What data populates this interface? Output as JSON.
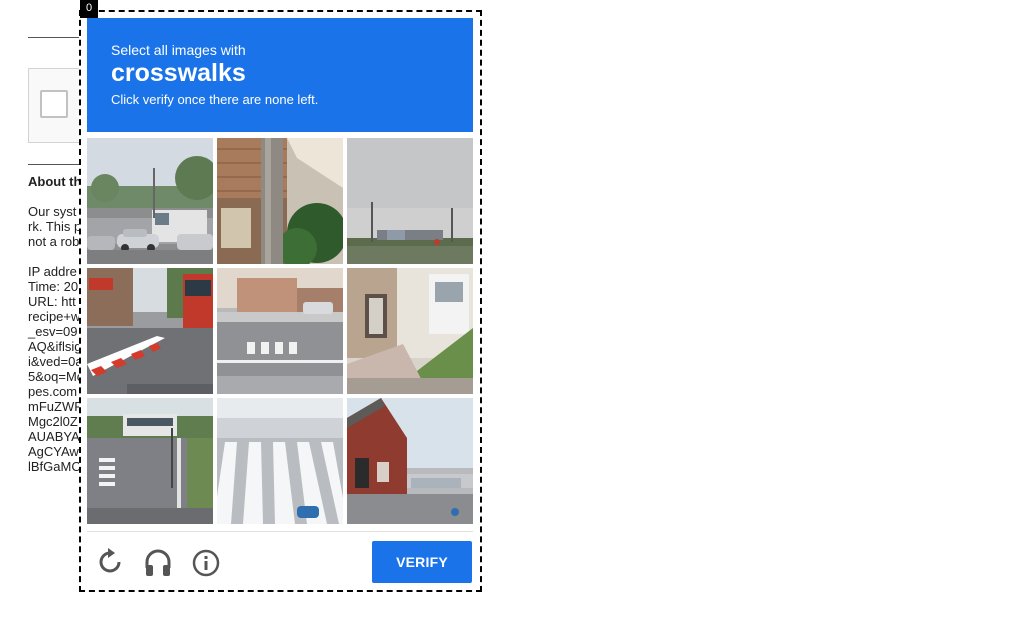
{
  "background_page": {
    "heading": "About th",
    "paragraph1_lines": [
      "Our syst",
      "rk. This p",
      "not a rob"
    ],
    "paragraph2_lines": [
      "IP addre",
      "Time: 20",
      "URL: htt",
      "recipe+w",
      "_esv=09",
      "AQ&iflsig",
      "i&ved=0a",
      "5&oq=Mo",
      "pes.com",
      "mFuZWF",
      "Mgc2l0Z",
      "AUABYA",
      "AgCYAw",
      "lBfGaMC"
    ]
  },
  "captcha": {
    "badge": "0",
    "instruction_top": "Select all images with",
    "keyword": "crosswalks",
    "instruction_bottom": "Click verify once there are none left.",
    "verify_label": "Verify",
    "colors": {
      "header": "#1a73e8",
      "button": "#1a73e8",
      "icon": "#555555"
    },
    "tiles": [
      {
        "id": "tile-1",
        "scene": "parking lot with truck and cars"
      },
      {
        "id": "tile-2",
        "scene": "utility pole by brick building"
      },
      {
        "id": "tile-3",
        "scene": "overcast highway sign"
      },
      {
        "id": "tile-4",
        "scene": "street with red bus and barrier"
      },
      {
        "id": "tile-5",
        "scene": "road with crosswalk markings"
      },
      {
        "id": "tile-6",
        "scene": "house front with sidewalk"
      },
      {
        "id": "tile-7",
        "scene": "bus near crosswalk"
      },
      {
        "id": "tile-8",
        "scene": "crosswalk stripes close-up"
      },
      {
        "id": "tile-9",
        "scene": "street with red buildings"
      }
    ],
    "controls": [
      {
        "name": "reload-icon"
      },
      {
        "name": "headphones-icon"
      },
      {
        "name": "info-icon"
      }
    ]
  }
}
